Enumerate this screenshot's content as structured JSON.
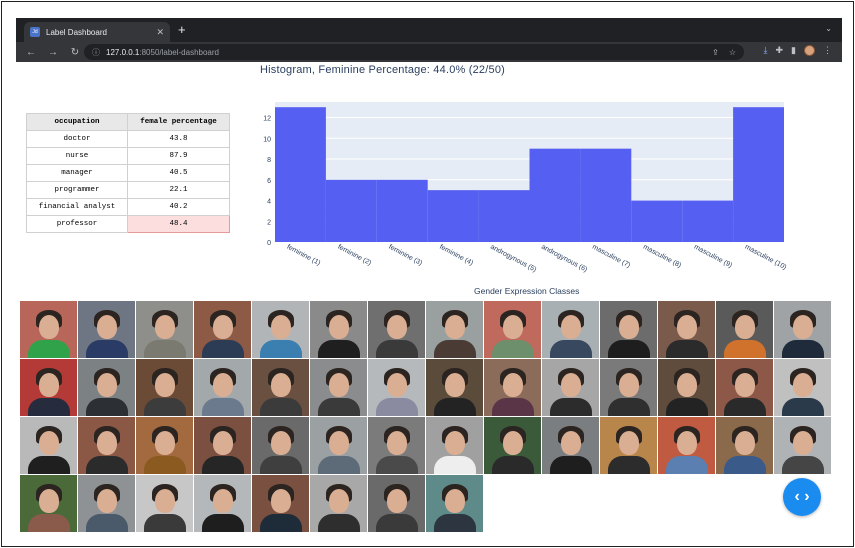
{
  "browser": {
    "tab_title": "Label Dashboard",
    "favicon_text": "Jd",
    "new_tab": "+",
    "url_host": "127.0.0.1",
    "url_rest": ":8050/label-dashboard"
  },
  "histogram": {
    "title": "Histogram, Feminine Percentage: 44.0% (22/50)"
  },
  "table": {
    "headers": [
      "occupation",
      "female percentage"
    ],
    "rows": [
      {
        "occupation": "doctor",
        "pct": "43.8"
      },
      {
        "occupation": "nurse",
        "pct": "87.9"
      },
      {
        "occupation": "manager",
        "pct": "40.5"
      },
      {
        "occupation": "programmer",
        "pct": "22.1"
      },
      {
        "occupation": "financial analyst",
        "pct": "40.2"
      },
      {
        "occupation": "professor",
        "pct": "48.4"
      }
    ],
    "highlight_color": "#fddede"
  },
  "chart_data": {
    "type": "bar",
    "title": "Histogram, Feminine Percentage: 44.0% (22/50)",
    "categories": [
      "feminine (1)",
      "feminine (2)",
      "feminine (3)",
      "feminine (4)",
      "androgynous (5)",
      "androgynous (6)",
      "masculine (7)",
      "masculine (8)",
      "masculine (9)",
      "masculine (10)"
    ],
    "values": [
      13,
      6,
      6,
      5,
      5,
      9,
      9,
      4,
      4,
      13
    ],
    "xlabel": "Gender Expression Classes",
    "ylabel": "",
    "ylim": [
      0,
      13.5
    ],
    "yticks": [
      0,
      2,
      4,
      6,
      8,
      10,
      12
    ],
    "grid": true,
    "colors": {
      "bar": "#5560f2",
      "plot_bg": "#e5ecf6",
      "grid": "#ffffff"
    }
  },
  "gallery": {
    "items": [
      {
        "bg": "#b9665a",
        "shirt": "#2fa24a"
      },
      {
        "bg": "#6d7682",
        "shirt": "#2a3b66"
      },
      {
        "bg": "#8e8e8a",
        "shirt": "#7a7a70"
      },
      {
        "bg": "#8c5a45",
        "shirt": "#2c3c55"
      },
      {
        "bg": "#b1b5b8",
        "shirt": "#3a7fb0"
      },
      {
        "bg": "#8a8a8a",
        "shirt": "#1f1f1f"
      },
      {
        "bg": "#6f6f6f",
        "shirt": "#3a3a3a"
      },
      {
        "bg": "#9aa0a0",
        "shirt": "#4a3b35"
      },
      {
        "bg": "#c06a5d",
        "shirt": "#6d8f6c"
      },
      {
        "bg": "#a9b0b3",
        "shirt": "#37485f"
      },
      {
        "bg": "#6c6c6c",
        "shirt": "#1e1e1e"
      },
      {
        "bg": "#7a5a4a",
        "shirt": "#2b2b2b"
      },
      {
        "bg": "#5a5a5a",
        "shirt": "#d0722c"
      },
      {
        "bg": "#9fa3a5",
        "shirt": "#1f2b3a"
      },
      {
        "bg": "#b33a36",
        "shirt": "#262b3d"
      },
      {
        "bg": "#7c8284",
        "shirt": "#2c2f33"
      },
      {
        "bg": "#6b4a36",
        "shirt": "#3c3c3c"
      },
      {
        "bg": "#a3a8ab",
        "shirt": "#6b7a8c"
      },
      {
        "bg": "#6a5040",
        "shirt": "#3b3b3b"
      },
      {
        "bg": "#8a8c8e",
        "shirt": "#3a3a3a"
      },
      {
        "bg": "#b6b9bb",
        "shirt": "#8a8aa0"
      },
      {
        "bg": "#5b4b3a",
        "shirt": "#232323"
      },
      {
        "bg": "#8b6c5a",
        "shirt": "#5a3548"
      },
      {
        "bg": "#a6a6a6",
        "shirt": "#2c2c2c"
      },
      {
        "bg": "#7a7a7a",
        "shirt": "#2f2f2f"
      },
      {
        "bg": "#5f4c3c",
        "shirt": "#232323"
      },
      {
        "bg": "#8e5848",
        "shirt": "#2a2a2a"
      },
      {
        "bg": "#c0c0c0",
        "shirt": "#2b3a4a"
      },
      {
        "bg": "#b9b9b9",
        "shirt": "#1f1f1f"
      },
      {
        "bg": "#8a5845",
        "shirt": "#2b2b2b"
      },
      {
        "bg": "#a36a40",
        "shirt": "#8a5a20"
      },
      {
        "bg": "#7c5040",
        "shirt": "#262626"
      },
      {
        "bg": "#6a6a6a",
        "shirt": "#3f3f3f"
      },
      {
        "bg": "#9ba0a3",
        "shirt": "#5d6a77"
      },
      {
        "bg": "#7b7b7b",
        "shirt": "#4a4a4a"
      },
      {
        "bg": "#a0a0a0",
        "shirt": "#eeeeee"
      },
      {
        "bg": "#3a5a3a",
        "shirt": "#2a2a2a"
      },
      {
        "bg": "#7a7e80",
        "shirt": "#1e1e1e"
      },
      {
        "bg": "#b8864a",
        "shirt": "#2c2c2c"
      },
      {
        "bg": "#c05a40",
        "shirt": "#5a7fb0"
      },
      {
        "bg": "#8a6a4a",
        "shirt": "#3a5a8a"
      },
      {
        "bg": "#b0b3b5",
        "shirt": "#454545"
      },
      {
        "bg": "#4a6a3a",
        "shirt": "#8a5a4a"
      },
      {
        "bg": "#8e9295",
        "shirt": "#4a5a6a"
      },
      {
        "bg": "#c7c7c7",
        "shirt": "#3a3a3a"
      },
      {
        "bg": "#b5b8ba",
        "shirt": "#1e1e1e"
      },
      {
        "bg": "#7a5040",
        "shirt": "#1e2c3a"
      },
      {
        "bg": "#a8a8a8",
        "shirt": "#2e2e2e"
      },
      {
        "bg": "#6a6a6a",
        "shirt": "#3a3a3a"
      },
      {
        "bg": "#5e8a8a",
        "shirt": "#2c3540"
      }
    ]
  },
  "fab": {
    "label": "‹ ›"
  }
}
